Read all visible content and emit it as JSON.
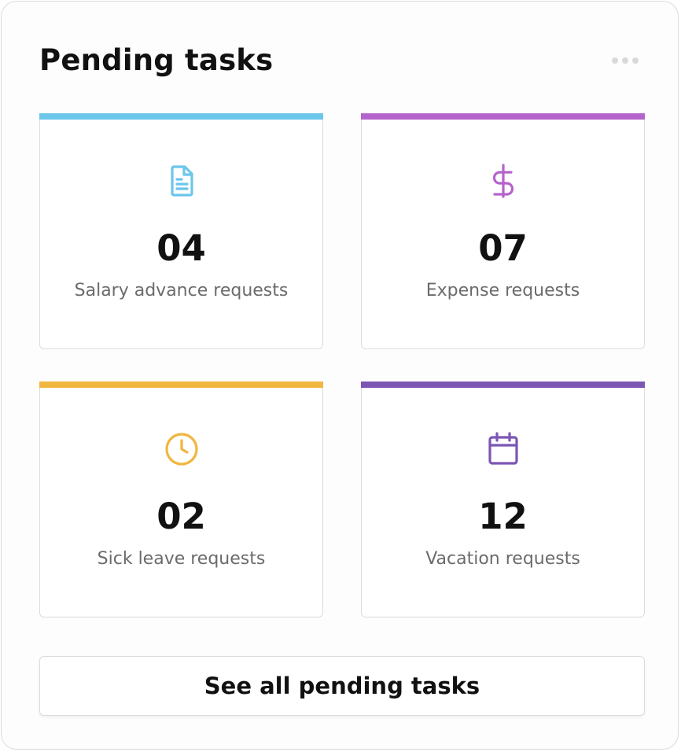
{
  "widget": {
    "title": "Pending tasks",
    "menu_icon": "more-horizontal-icon"
  },
  "tiles": [
    {
      "count": "04",
      "label": "Salary advance requests",
      "icon": "document-icon",
      "color": "#6bc6ea"
    },
    {
      "count": "07",
      "label": "Expense requests",
      "icon": "dollar-icon",
      "color": "#b563cc"
    },
    {
      "count": "02",
      "label": "Sick leave requests",
      "icon": "clock-icon",
      "color": "#f0b63f"
    },
    {
      "count": "12",
      "label": "Vacation requests",
      "icon": "calendar-icon",
      "color": "#7b56b3"
    }
  ],
  "footer": {
    "see_all_label": "See all pending tasks"
  }
}
